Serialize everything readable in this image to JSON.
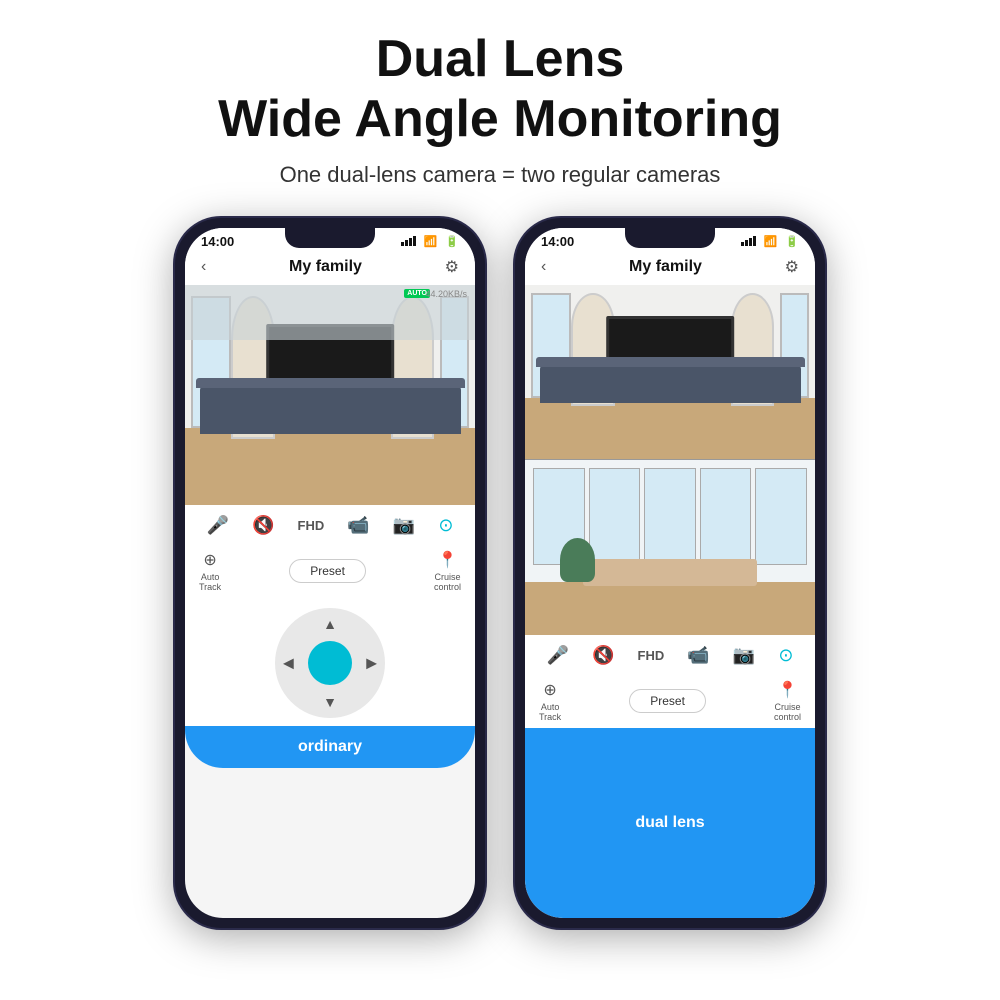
{
  "header": {
    "title_line1": "Dual Lens",
    "title_line2": "Wide Angle Monitoring",
    "subtitle": "One dual-lens camera = two regular cameras"
  },
  "phones": [
    {
      "id": "ordinary",
      "time": "14:00",
      "nav_title": "My family",
      "speed": "44.20KB/s",
      "auto_badge": "AUTO",
      "controls": [
        "mic",
        "mute",
        "FHD",
        "record",
        "capture",
        "settings"
      ],
      "action_left_label": "Auto\nTrack",
      "action_center_label": "Preset",
      "action_right_label": "Cruise\ncontrol",
      "label": "ordinary",
      "view_type": "single"
    },
    {
      "id": "dual",
      "time": "14:00",
      "nav_title": "My family",
      "speed": "",
      "auto_badge": "",
      "controls": [
        "mic",
        "mute",
        "FHD",
        "record",
        "capture",
        "settings"
      ],
      "action_left_label": "Auto\nTrack",
      "action_center_label": "Preset",
      "action_right_label": "Cruise\ncontrol",
      "label": "dual lens",
      "view_type": "dual"
    }
  ],
  "icons": {
    "back": "‹",
    "settings": "⚙",
    "mic": "🎤",
    "mute": "🔇",
    "record": "📹",
    "capture": "📷",
    "auto_track": "⊕",
    "cruise": "📍",
    "up_arrow": "▲",
    "down_arrow": "▼",
    "left_arrow": "◀",
    "right_arrow": "▶"
  }
}
